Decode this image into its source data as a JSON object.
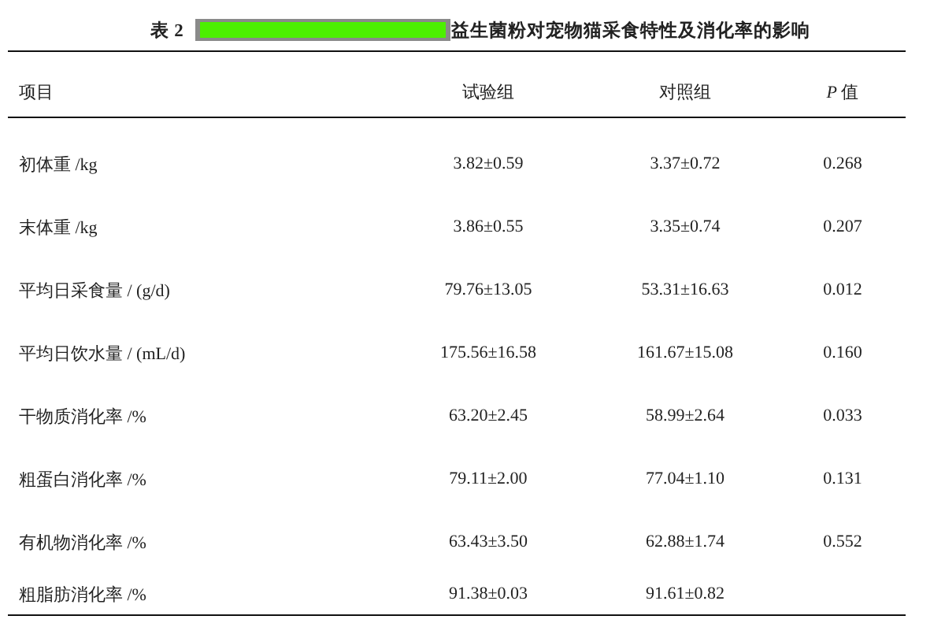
{
  "table": {
    "caption_label": "表 2",
    "redacted": true,
    "caption": "益生菌粉对宠物猫采食特性及消化率的影响",
    "columns": [
      "项目",
      "试验组",
      "对照组",
      "*P* 值"
    ],
    "rows": [
      {
        "item": "初体重 /kg",
        "trial": "3.82±0.59",
        "control": "3.37±0.72",
        "p": "0.268"
      },
      {
        "item": "末体重 /kg",
        "trial": "3.86±0.55",
        "control": "3.35±0.74",
        "p": "0.207"
      },
      {
        "item": "平均日采食量 / (g/d)",
        "trial": "79.76±13.05",
        "control": "53.31±16.63",
        "p": "0.012"
      },
      {
        "item": "平均日饮水量 / (mL/d)",
        "trial": "175.56±16.58",
        "control": "161.67±15.08",
        "p": "0.160"
      },
      {
        "item": "干物质消化率 /%",
        "trial": "63.20±2.45",
        "control": "58.99±2.64",
        "p": "0.033"
      },
      {
        "item": "粗蛋白消化率 /%",
        "trial": "79.11±2.00",
        "control": "77.04±1.10",
        "p": "0.131"
      },
      {
        "item": "有机物消化率 /%",
        "trial": "63.43±3.50",
        "control": "62.88±1.74",
        "p": "0.552"
      },
      {
        "item": "粗脂肪消化率 /%",
        "trial": "91.38±0.03",
        "control": "91.61±0.82"
      }
    ]
  }
}
